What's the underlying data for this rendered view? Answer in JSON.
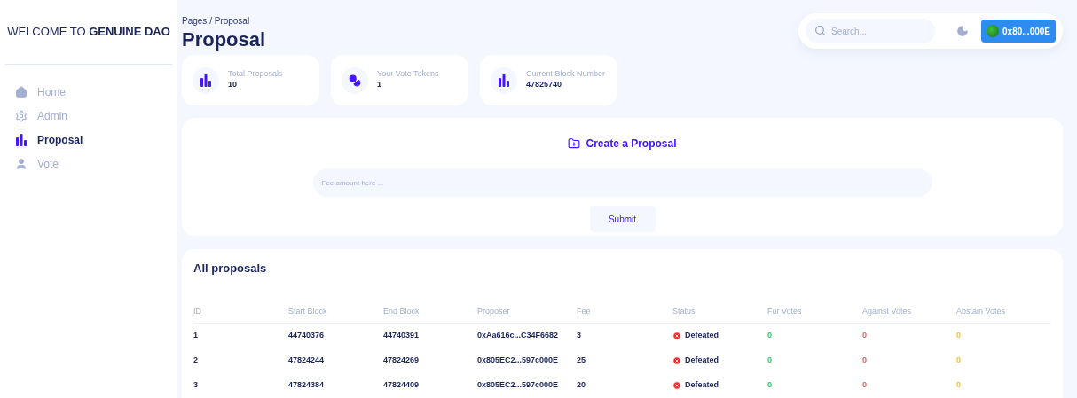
{
  "sidebar": {
    "brand": "WELCOME TO **GENUINE DAO**",
    "items": [
      {
        "label": "Home",
        "selected": false
      },
      {
        "label": "Admin",
        "selected": false
      },
      {
        "label": "Proposal",
        "selected": true
      },
      {
        "label": "Vote",
        "selected": false
      }
    ]
  },
  "header": {
    "breadcrumb": "Pages / Proposal",
    "title": "Proposal",
    "search": {
      "placeholder": "Search..."
    },
    "wallet": "0x80...000E"
  },
  "stats": [
    {
      "label": "Total Proposals",
      "value": "10"
    },
    {
      "label": "Your Vote Tokens",
      "value": "1"
    },
    {
      "label": "Current Block Number",
      "value": "47825740"
    }
  ],
  "create": {
    "title": "Create a Proposal",
    "fee": {
      "placeholder": "Fee amount here ..."
    },
    "submit": "Submit"
  },
  "table": {
    "title": "All proposals",
    "columns": [
      "ID",
      "Start Block",
      "End Block",
      "Proposer",
      "Fee",
      "Status",
      "For Votes",
      "Against Votes",
      "Abstain Votes"
    ],
    "rows": [
      {
        "id": "1",
        "start": "44740376",
        "end": "44740391",
        "proposer": "0xAa616c...C34F6682",
        "fee": "3",
        "status": {
          "kind": "defeated",
          "label": "Defeated"
        },
        "for": "0",
        "against": "0",
        "abstain": "0"
      },
      {
        "id": "2",
        "start": "47824244",
        "end": "47824269",
        "proposer": "0x805EC2...597c000E",
        "fee": "25",
        "status": {
          "kind": "defeated",
          "label": "Defeated"
        },
        "for": "0",
        "against": "0",
        "abstain": "0"
      },
      {
        "id": "3",
        "start": "47824384",
        "end": "47824409",
        "proposer": "0x805EC2...597c000E",
        "fee": "20",
        "status": {
          "kind": "defeated",
          "label": "Defeated"
        },
        "for": "0",
        "against": "0",
        "abstain": "0"
      }
    ]
  }
}
